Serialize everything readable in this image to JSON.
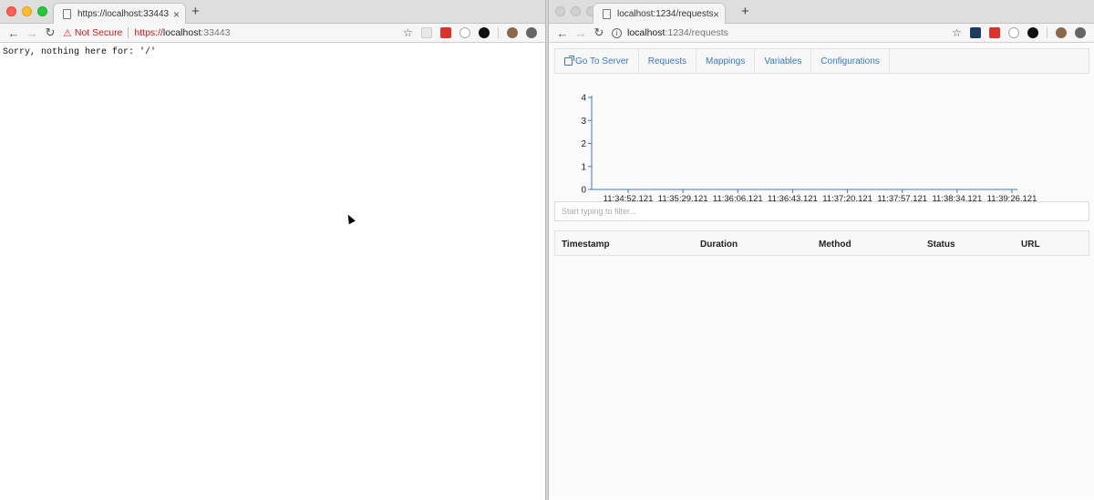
{
  "left_window": {
    "tab": {
      "title": "https://localhost:33443",
      "close": "×"
    },
    "new_tab": "+",
    "toolbar": {
      "back": "←",
      "forward": "→",
      "reload": "↻",
      "security_icon": "⚠",
      "security_label": "Not Secure",
      "url_scheme": "https://",
      "url_host": "localhost",
      "url_rest": ":33443",
      "bookmark": "☆"
    },
    "body_text": "Sorry, nothing here for: '/'"
  },
  "right_window": {
    "tab": {
      "title": "localhost:1234/requests",
      "close": "×"
    },
    "new_tab": "+",
    "toolbar": {
      "back": "←",
      "forward": "→",
      "reload": "↻",
      "info_icon": "i",
      "url_host": "localhost",
      "url_rest": ":1234/requests",
      "bookmark": "☆"
    },
    "nav": {
      "go_to_server": "Go To Server",
      "requests": "Requests",
      "mappings": "Mappings",
      "variables": "Variables",
      "configurations": "Configurations"
    },
    "filter_placeholder": "Start typing to filter...",
    "table_headers": [
      "Timestamp",
      "Duration",
      "Method",
      "Status",
      "URL"
    ]
  },
  "chart_data": {
    "type": "line",
    "categories": [
      "11:34:52.121",
      "11:35:29.121",
      "11:36:06.121",
      "11:36:43.121",
      "11:37:20.121",
      "11:37:57.121",
      "11:38:34.121",
      "11:39:26.121"
    ],
    "series": [],
    "yticks": [
      0,
      1,
      2,
      3,
      4
    ],
    "ylim": [
      0,
      4
    ],
    "title": "",
    "xlabel": "",
    "ylabel": "",
    "grid": false
  },
  "colors": {
    "accent": "#3b79c6",
    "axis": "#3b79c6",
    "not_secure": "#c5221f"
  }
}
